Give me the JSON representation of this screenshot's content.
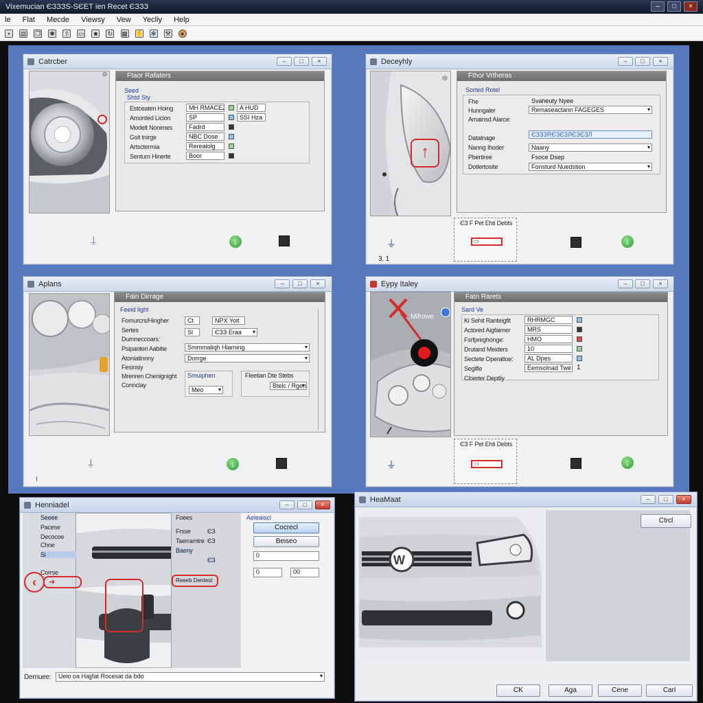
{
  "app": {
    "title": "Vixemucian ЄЗЗЗS-SЄЕТ ien Recet ЄЗЗЗ",
    "window_controls": [
      "–",
      "□",
      "×"
    ]
  },
  "menu": [
    "le",
    "Flat",
    "Mecde",
    "Viewsy",
    "Vew",
    "Yecliy",
    "Help"
  ],
  "toolbar_icons": [
    "save-icon",
    "print-icon",
    "copy-icon",
    "gear-icon",
    "export-icon",
    "doc-icon",
    "stop-icon",
    "refresh-icon",
    "grid-icon",
    "hand-icon",
    "settings-icon",
    "tool-icon",
    "info-icon"
  ],
  "windows": {
    "w1": {
      "title": "Catrcber",
      "panel_title": "Ftaor Rafaters",
      "group_title": "Seed",
      "group_sub": "Shtd Sty",
      "rows": [
        {
          "label": "Estceaten Hoing",
          "value": "MH RMACEZ",
          "extra": "A HUD"
        },
        {
          "label": "Amonted Liclon",
          "value": "SP",
          "extra": "SSI Hza"
        },
        {
          "label": "Modelt Nonimes",
          "value": "Fadrd"
        },
        {
          "label": "Gsit tnirge",
          "value": "NBC Dose"
        },
        {
          "label": "Artsctermia",
          "value": "Rerealolg"
        },
        {
          "label": "Sentum Hinerte",
          "value": "Boor"
        }
      ]
    },
    "w2": {
      "title": "Deceyhly",
      "panel_title": "Fthor Vrtheras",
      "group_title": "Sorted Rotel",
      "rows": [
        {
          "label": "Fhe",
          "value": "Svaheuty Nyee"
        },
        {
          "label": "Hunngaler",
          "value": "Remaseactann FAGEGES"
        },
        {
          "label": "Amainsd Alarce:",
          "value": ""
        },
        {
          "label": "Datalnage",
          "value": "ЄЗЗЗRЄЗЄЗЛЄЗЄЗЛ"
        },
        {
          "label": "Nanng Ihoder",
          "value": "Naany"
        },
        {
          "label": "Pbertiree",
          "value": "Fsoce Dsep"
        },
        {
          "label": "Dotlertosite",
          "value": "Fonsturd Nuedstion"
        }
      ],
      "footer_text": "ЄЗ F Pet Ehti Debts",
      "footer_page": "3.  1"
    },
    "w3": {
      "title": "Aplans",
      "panel_title": "Fain Dirrage",
      "group_title": "Feeid light",
      "rows": [
        {
          "label": "Fomurcrs/Hingher",
          "value": "Ct",
          "extra": "NPX Yolt"
        },
        {
          "label": "Sertes",
          "value": "Sl",
          "extra": "ЄЗЗ Eraa"
        },
        {
          "label": "Durnneccoars:",
          "value": ""
        },
        {
          "label": "Psipanteri Aabitie",
          "value": "Smmmaliqh Hiarning"
        },
        {
          "label": "Atoniatinnny",
          "value": "Dorrge"
        },
        {
          "label": "Fesinsiy",
          "value": ""
        },
        {
          "label": "Mrenren Chenignight",
          "value": "Smuiphen",
          "extra": "Fleetian Dte Stebs"
        },
        {
          "label": "Connclay",
          "value": "Meo",
          "extra": "Btelc / Rgen"
        }
      ]
    },
    "w4": {
      "title": "Eypy Italey",
      "panel_title": "Fatn Rarets",
      "group_title": "Sard Ve",
      "callout": "Mifrowe",
      "rows": [
        {
          "label": "Ki Sehit Ranteigfit",
          "value": "RHRMGC"
        },
        {
          "label": "Actored Aigfaimer",
          "value": "MRS"
        },
        {
          "label": "Fsrfpreghonge:",
          "value": "HMO"
        },
        {
          "label": "Drutand Meiders",
          "value": "10"
        },
        {
          "label": "Sectete Operatloe:",
          "value": "AL Dpes"
        },
        {
          "label": "Segifle",
          "value": "Eemsolnad Twe",
          "extra": "1"
        },
        {
          "label": "Cloerter Deptliy",
          "value": ""
        }
      ],
      "footer_text": "ЄЗ F Pet Ehti Debts"
    },
    "w5": {
      "title": "Henniadel",
      "list": [
        "Seeee",
        "Pacese",
        "Decocoe",
        "Chne",
        "Si",
        "",
        "Corrse"
      ],
      "mid_list": [
        {
          "label": "Foees",
          "value": ""
        },
        {
          "label": "Frsse",
          "value": "ЄЗ"
        },
        {
          "label": "Taerramtre",
          "value": "ЄЗ"
        },
        {
          "label": "Baeny",
          "value": ""
        },
        {
          "label": "",
          "value": "ЄЗ"
        }
      ],
      "side_title": "Aeleaiscl",
      "buttons": [
        "Cocrecl",
        "Beiseo"
      ],
      "inputs": [
        "0",
        "0",
        "00"
      ],
      "highlight_button": "Reeeb Dentest",
      "status_label": "Dernuee:",
      "status_value": "Ueio oa Hajjfat Rocesat da bdo"
    },
    "w6": {
      "title": "HeaMaat",
      "top_button": "Ctrcl",
      "buttons": [
        "CK",
        "Aga",
        "Cene",
        "Carl"
      ]
    }
  }
}
